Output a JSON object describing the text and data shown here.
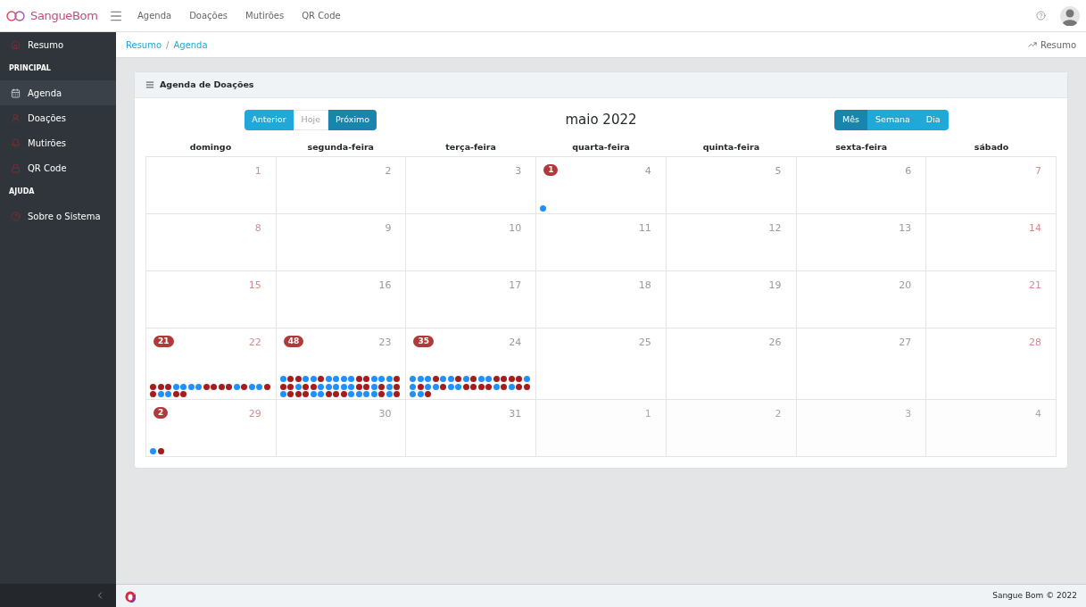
{
  "topbar": {
    "brand": "SangueBom",
    "nav": [
      "Agenda",
      "Doações",
      "Mutirões",
      "QR Code"
    ]
  },
  "sidebar": {
    "items": [
      {
        "kind": "link",
        "label": "Resumo",
        "selected": false
      },
      {
        "kind": "header",
        "label": "PRINCIPAL"
      },
      {
        "kind": "link",
        "label": "Agenda",
        "selected": true
      },
      {
        "kind": "link",
        "label": "Doações",
        "selected": false
      },
      {
        "kind": "link",
        "label": "Mutirões",
        "selected": false
      },
      {
        "kind": "link",
        "label": "QR Code",
        "selected": false
      },
      {
        "kind": "header",
        "label": "AJUDA"
      },
      {
        "kind": "link",
        "label": "Sobre o Sistema",
        "selected": false
      }
    ]
  },
  "breadcrumb": [
    "Resumo",
    "Agenda"
  ],
  "breadcrumb_separator": "/",
  "breadcrumb_action": "Resumo",
  "card": {
    "title": "Agenda de Doações",
    "nav_buttons": [
      {
        "label": "Anterior",
        "disabled": false
      },
      {
        "label": "Hoje",
        "disabled": true
      },
      {
        "label": "Próximo",
        "disabled": false
      }
    ],
    "month_title": "maio 2022",
    "views": [
      {
        "label": "Mês",
        "selected": true
      },
      {
        "label": "Semana",
        "selected": false
      },
      {
        "label": "Dia",
        "selected": false
      }
    ],
    "weekdays": [
      "domingo",
      "segunda-feira",
      "terça-feira",
      "quarta-feira",
      "quinta-feira",
      "sexta-feira",
      "sábado"
    ],
    "weeks": [
      [
        {
          "day": "1",
          "other_month": false
        },
        {
          "day": "2",
          "other_month": false
        },
        {
          "day": "3",
          "other_month": false
        },
        {
          "day": "4",
          "other_month": false,
          "count": "1",
          "dots": [
            {
              "color": "#1e90ff"
            }
          ]
        },
        {
          "day": "5",
          "other_month": false
        },
        {
          "day": "6",
          "other_month": false
        },
        {
          "day": "7",
          "other_month": false
        }
      ],
      [
        {
          "day": "8",
          "other_month": false
        },
        {
          "day": "9",
          "other_month": false
        },
        {
          "day": "10",
          "other_month": false
        },
        {
          "day": "11",
          "other_month": false
        },
        {
          "day": "12",
          "other_month": false
        },
        {
          "day": "13",
          "other_month": false
        },
        {
          "day": "14",
          "other_month": false
        }
      ],
      [
        {
          "day": "15",
          "other_month": false
        },
        {
          "day": "16",
          "other_month": false
        },
        {
          "day": "17",
          "other_month": false
        },
        {
          "day": "18",
          "other_month": false
        },
        {
          "day": "19",
          "other_month": false
        },
        {
          "day": "20",
          "other_month": false
        },
        {
          "day": "21",
          "other_month": false
        }
      ],
      [
        {
          "day": "22",
          "other_month": false,
          "count": "21",
          "dots": [
            {
              "color": "#a61c1c"
            },
            {
              "color": "#a61c1c"
            },
            {
              "color": "#a61c1c"
            },
            {
              "color": "#1e90ff"
            },
            {
              "color": "#1e90ff"
            },
            {
              "color": "#1e90ff"
            },
            {
              "color": "#1e90ff"
            },
            {
              "color": "#a61c1c"
            },
            {
              "color": "#a61c1c"
            },
            {
              "color": "#a61c1c"
            },
            {
              "color": "#a61c1c"
            },
            {
              "color": "#1e90ff"
            },
            {
              "color": "#a61c1c"
            },
            {
              "color": "#1e90ff"
            },
            {
              "color": "#1e90ff"
            },
            {
              "color": "#a61c1c"
            },
            {
              "color": "#a61c1c"
            },
            {
              "color": "#1e90ff"
            },
            {
              "color": "#1e90ff"
            },
            {
              "color": "#a61c1c"
            },
            {
              "color": "#a61c1c"
            }
          ]
        },
        {
          "day": "23",
          "other_month": false,
          "count": "48",
          "dots": [
            {
              "color": "#1e90ff"
            },
            {
              "color": "#a61c1c"
            },
            {
              "color": "#a61c1c"
            },
            {
              "color": "#1e90ff"
            },
            {
              "color": "#1e90ff"
            },
            {
              "color": "#a61c1c"
            },
            {
              "color": "#1e90ff"
            },
            {
              "color": "#1e90ff"
            },
            {
              "color": "#1e90ff"
            },
            {
              "color": "#1e90ff"
            },
            {
              "color": "#a61c1c"
            },
            {
              "color": "#a61c1c"
            },
            {
              "color": "#1e90ff"
            },
            {
              "color": "#1e90ff"
            },
            {
              "color": "#1e90ff"
            },
            {
              "color": "#a61c1c"
            },
            {
              "color": "#a61c1c"
            },
            {
              "color": "#a61c1c"
            },
            {
              "color": "#1e90ff"
            },
            {
              "color": "#a61c1c"
            },
            {
              "color": "#a61c1c"
            },
            {
              "color": "#1e90ff"
            },
            {
              "color": "#1e90ff"
            },
            {
              "color": "#1e90ff"
            },
            {
              "color": "#1e90ff"
            },
            {
              "color": "#1e90ff"
            },
            {
              "color": "#a61c1c"
            },
            {
              "color": "#a61c1c"
            },
            {
              "color": "#1e90ff"
            },
            {
              "color": "#a61c1c"
            },
            {
              "color": "#1e90ff"
            },
            {
              "color": "#a61c1c"
            },
            {
              "color": "#1e90ff"
            },
            {
              "color": "#a61c1c"
            },
            {
              "color": "#a61c1c"
            },
            {
              "color": "#a61c1c"
            },
            {
              "color": "#1e90ff"
            },
            {
              "color": "#1e90ff"
            },
            {
              "color": "#a61c1c"
            },
            {
              "color": "#a61c1c"
            },
            {
              "color": "#a61c1c"
            },
            {
              "color": "#1e90ff"
            },
            {
              "color": "#1e90ff"
            },
            {
              "color": "#1e90ff"
            },
            {
              "color": "#1e90ff"
            },
            {
              "color": "#a61c1c"
            },
            {
              "color": "#1e90ff"
            },
            {
              "color": "#a61c1c"
            }
          ]
        },
        {
          "day": "24",
          "other_month": false,
          "count": "35",
          "dots": [
            {
              "color": "#1e90ff"
            },
            {
              "color": "#1e90ff"
            },
            {
              "color": "#1e90ff"
            },
            {
              "color": "#a61c1c"
            },
            {
              "color": "#1e90ff"
            },
            {
              "color": "#1e90ff"
            },
            {
              "color": "#a61c1c"
            },
            {
              "color": "#1e90ff"
            },
            {
              "color": "#a61c1c"
            },
            {
              "color": "#1e90ff"
            },
            {
              "color": "#1e90ff"
            },
            {
              "color": "#a61c1c"
            },
            {
              "color": "#a61c1c"
            },
            {
              "color": "#a61c1c"
            },
            {
              "color": "#a61c1c"
            },
            {
              "color": "#1e90ff"
            },
            {
              "color": "#1e90ff"
            },
            {
              "color": "#a61c1c"
            },
            {
              "color": "#1e90ff"
            },
            {
              "color": "#1e90ff"
            },
            {
              "color": "#a61c1c"
            },
            {
              "color": "#1e90ff"
            },
            {
              "color": "#1e90ff"
            },
            {
              "color": "#a61c1c"
            },
            {
              "color": "#a61c1c"
            },
            {
              "color": "#a61c1c"
            },
            {
              "color": "#a61c1c"
            },
            {
              "color": "#1e90ff"
            },
            {
              "color": "#a61c1c"
            },
            {
              "color": "#1e90ff"
            },
            {
              "color": "#a61c1c"
            },
            {
              "color": "#a61c1c"
            },
            {
              "color": "#1e90ff"
            },
            {
              "color": "#1e90ff"
            },
            {
              "color": "#a61c1c"
            }
          ]
        },
        {
          "day": "25",
          "other_month": false
        },
        {
          "day": "26",
          "other_month": false
        },
        {
          "day": "27",
          "other_month": false
        },
        {
          "day": "28",
          "other_month": false
        }
      ],
      [
        {
          "day": "29",
          "other_month": false,
          "count": "2",
          "dots": [
            {
              "color": "#1e90ff"
            },
            {
              "color": "#a61c1c"
            }
          ]
        },
        {
          "day": "30",
          "other_month": false
        },
        {
          "day": "31",
          "other_month": false
        },
        {
          "day": "1",
          "other_month": true
        },
        {
          "day": "2",
          "other_month": true
        },
        {
          "day": "3",
          "other_month": true
        },
        {
          "day": "4",
          "other_month": true
        }
      ]
    ]
  },
  "footer": {
    "copyright": "Sangue Bom © 2022"
  }
}
